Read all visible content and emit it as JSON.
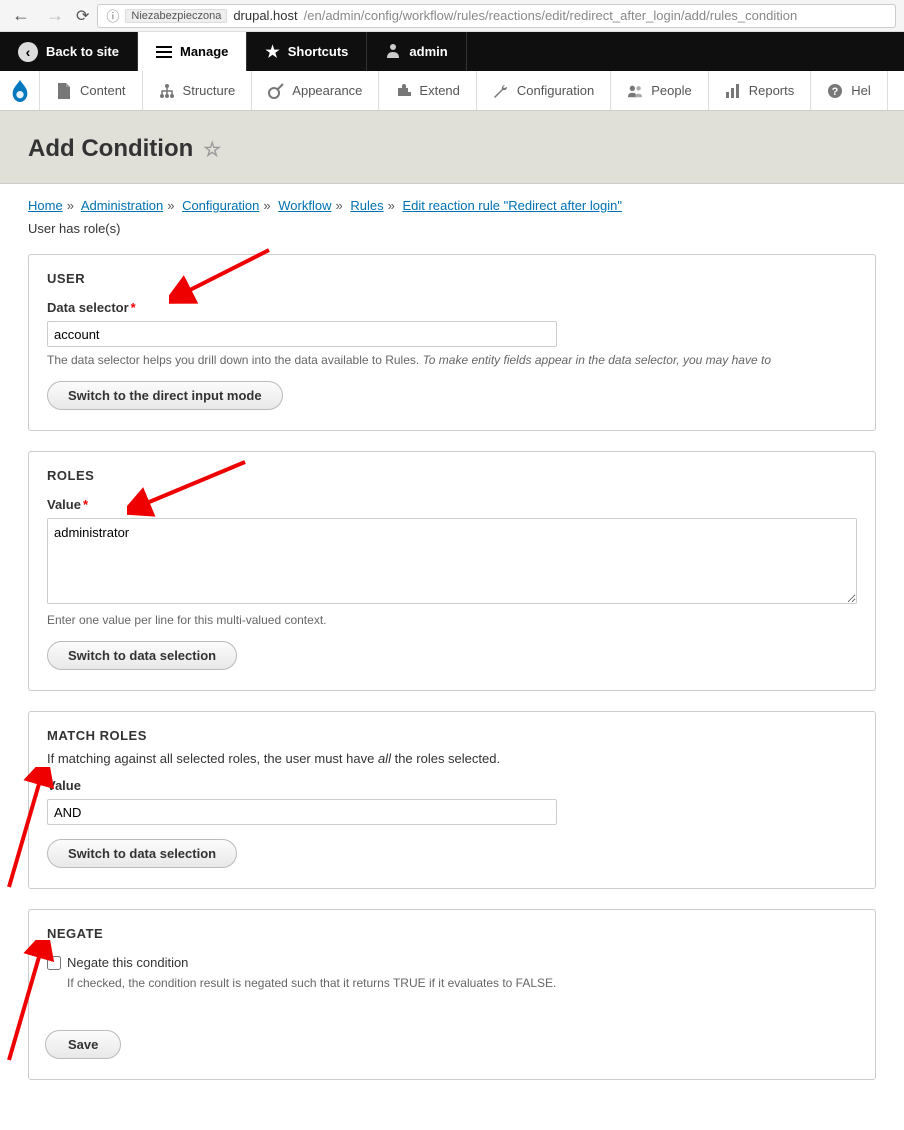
{
  "browser": {
    "security_label": "Niezabezpieczona",
    "url_host": "drupal.host",
    "url_path": "/en/admin/config/workflow/rules/reactions/edit/redirect_after_login/add/rules_condition"
  },
  "toolbar": {
    "back_to_site": "Back to site",
    "manage": "Manage",
    "shortcuts": "Shortcuts",
    "admin": "admin"
  },
  "admin_menu": {
    "content": "Content",
    "structure": "Structure",
    "appearance": "Appearance",
    "extend": "Extend",
    "configuration": "Configuration",
    "people": "People",
    "reports": "Reports",
    "help": "Hel"
  },
  "page": {
    "title": "Add Condition",
    "breadcrumb": [
      "Home",
      "Administration",
      "Configuration",
      "Workflow",
      "Rules",
      "Edit reaction rule \"Redirect after login\""
    ],
    "subtitle": "User has role(s)"
  },
  "user_section": {
    "legend": "USER",
    "label": "Data selector",
    "value": "account",
    "desc_plain": "The data selector helps you drill down into the data available to Rules. ",
    "desc_italic": "To make entity fields appear in the data selector, you may have to",
    "button": "Switch to the direct input mode"
  },
  "roles_section": {
    "legend": "ROLES",
    "label": "Value",
    "value": "administrator",
    "desc": "Enter one value per line for this multi-valued context.",
    "button": "Switch to data selection"
  },
  "match_section": {
    "legend": "MATCH ROLES",
    "desc_pre": "If matching against all selected roles, the user must have ",
    "desc_em": "all",
    "desc_post": " the roles selected.",
    "label": "Value",
    "value": "AND",
    "button": "Switch to data selection"
  },
  "negate_section": {
    "legend": "NEGATE",
    "checkbox_label": "Negate this condition",
    "desc": "If checked, the condition result is negated such that it returns TRUE if it evaluates to FALSE."
  },
  "save_button": "Save"
}
